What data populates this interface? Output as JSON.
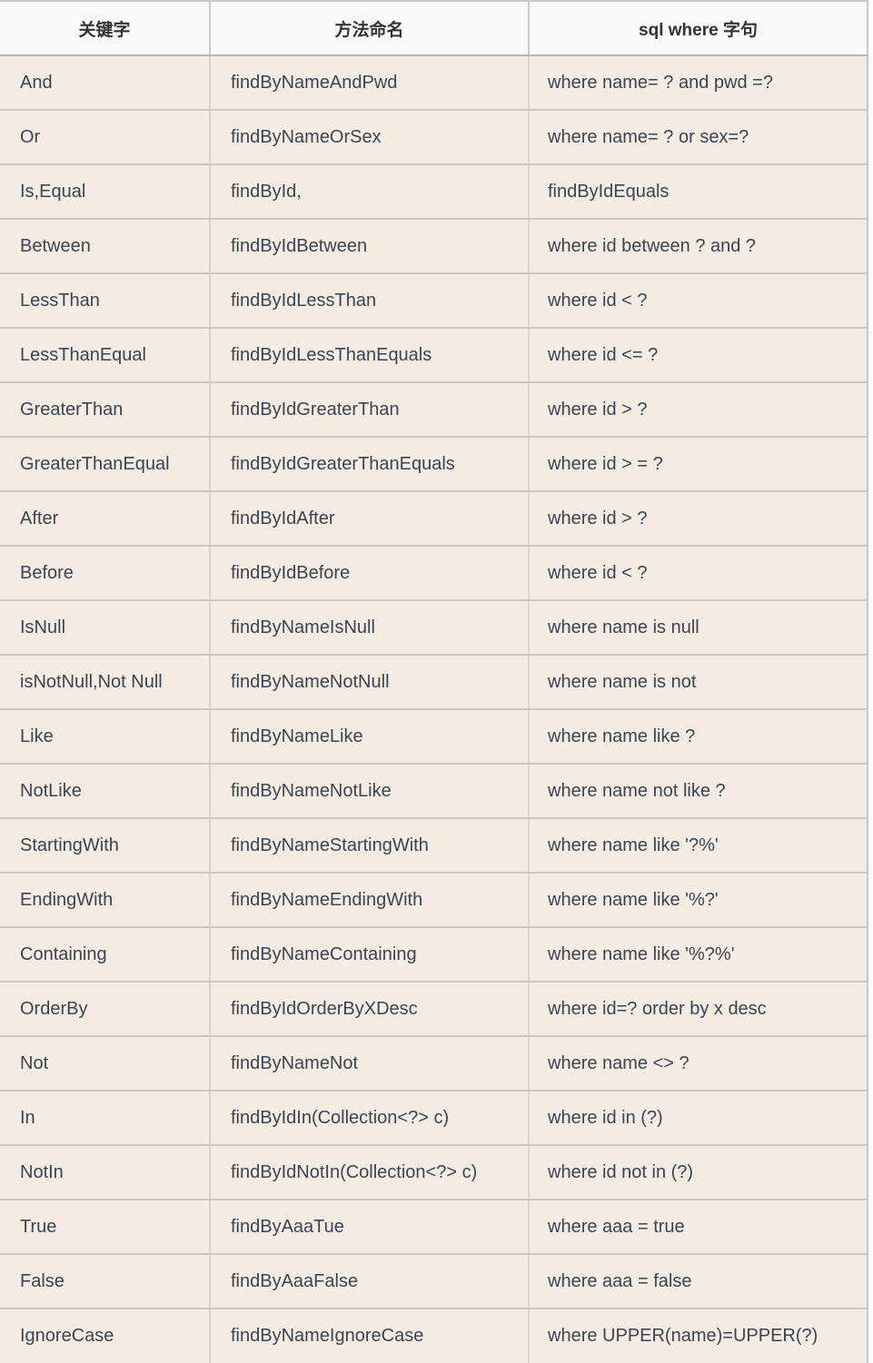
{
  "table": {
    "headers": [
      "关键字",
      "方法命名",
      "sql where 字句"
    ],
    "rows": [
      {
        "keyword": "And",
        "method": "findByNameAndPwd",
        "sql": "where name= ? and pwd =?"
      },
      {
        "keyword": "Or",
        "method": "findByNameOrSex",
        "sql": "where name= ? or sex=?"
      },
      {
        "keyword": "Is,Equal",
        "method": "findById,",
        "sql": "findByIdEquals"
      },
      {
        "keyword": "Between",
        "method": "findByIdBetween",
        "sql": "where id between ? and ?"
      },
      {
        "keyword": "LessThan",
        "method": "findByIdLessThan",
        "sql": "where id < ?"
      },
      {
        "keyword": "LessThanEqual",
        "method": "findByIdLessThanEquals",
        "sql": "where id <= ?"
      },
      {
        "keyword": "GreaterThan",
        "method": "findByIdGreaterThan",
        "sql": "where id > ?"
      },
      {
        "keyword": "GreaterThanEqual",
        "method": "findByIdGreaterThanEquals",
        "sql": "where id > = ?"
      },
      {
        "keyword": "After",
        "method": "findByIdAfter",
        "sql": "where id > ?"
      },
      {
        "keyword": "Before",
        "method": "findByIdBefore",
        "sql": "where id < ?"
      },
      {
        "keyword": "IsNull",
        "method": "findByNameIsNull",
        "sql": "where name is null"
      },
      {
        "keyword": "isNotNull,Not Null",
        "method": "findByNameNotNull",
        "sql": "where name is not"
      },
      {
        "keyword": "Like",
        "method": "findByNameLike",
        "sql": "where name like ?"
      },
      {
        "keyword": "NotLike",
        "method": "findByNameNotLike",
        "sql": "where name not like ?"
      },
      {
        "keyword": "StartingWith",
        "method": "findByNameStartingWith",
        "sql": "where name like '?%'"
      },
      {
        "keyword": "EndingWith",
        "method": "findByNameEndingWith",
        "sql": "where name like '%?'"
      },
      {
        "keyword": "Containing",
        "method": "findByNameContaining",
        "sql": "where name like '%?%'"
      },
      {
        "keyword": "OrderBy",
        "method": "findByIdOrderByXDesc",
        "sql": "where id=? order by x desc"
      },
      {
        "keyword": "Not",
        "method": "findByNameNot",
        "sql": "where name <> ?"
      },
      {
        "keyword": "In",
        "method": "findByIdIn(Collection<?> c)",
        "sql": "where id in (?)"
      },
      {
        "keyword": "NotIn",
        "method": "findByIdNotIn(Collection<?> c)",
        "sql": "where id not in (?)"
      },
      {
        "keyword": "True",
        "method": "findByAaaTue",
        "sql": "where aaa = true"
      },
      {
        "keyword": "False",
        "method": "findByAaaFalse",
        "sql": "where aaa = false"
      },
      {
        "keyword": "IgnoreCase",
        "method": "findByNameIgnoreCase",
        "sql": "where UPPER(name)=UPPER(?)"
      }
    ]
  },
  "colors": {
    "header_bg": "#f9f9f9",
    "row_bg": "#f4ece3",
    "text": "#3b4451",
    "header_text": "#333333",
    "border_outer": "#c9c9c9",
    "border_inner": "#d8d3cb"
  }
}
